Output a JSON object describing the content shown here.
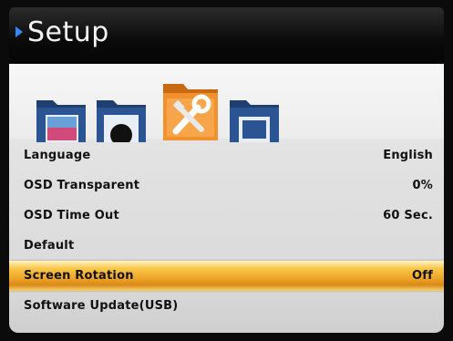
{
  "header": {
    "title": "Setup",
    "accent_color": "#2f8cff"
  },
  "icons": [
    {
      "name": "picture-folder-icon",
      "selected": false
    },
    {
      "name": "camera-folder-icon",
      "selected": false
    },
    {
      "name": "tools-folder-icon",
      "selected": true
    },
    {
      "name": "screen-folder-icon",
      "selected": false
    }
  ],
  "menu": {
    "items": [
      {
        "label": "Language",
        "value": "English",
        "selected": false
      },
      {
        "label": "OSD Transparent",
        "value": "0%",
        "selected": false
      },
      {
        "label": "OSD Time Out",
        "value": "60 Sec.",
        "selected": false
      },
      {
        "label": "Default",
        "value": "",
        "selected": false
      },
      {
        "label": "Screen Rotation",
        "value": "Off",
        "selected": true
      },
      {
        "label": "Software Update(USB)",
        "value": "",
        "selected": false
      }
    ]
  },
  "colors": {
    "selected_bar": "#f0a82a",
    "folder_blue": "#2b4f86",
    "folder_orange": "#e88a2a"
  }
}
